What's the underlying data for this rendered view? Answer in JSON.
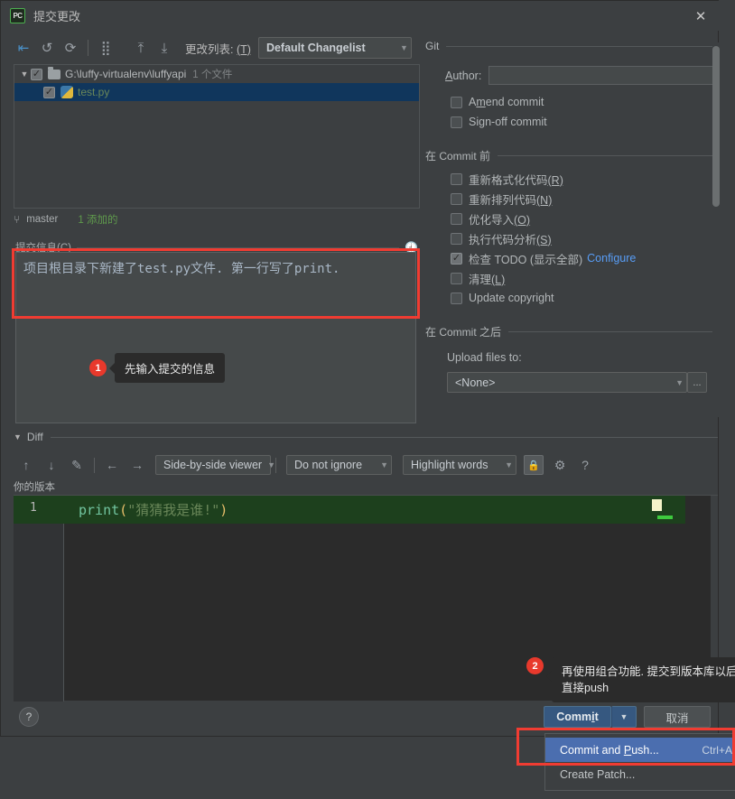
{
  "window": {
    "title": "提交更改",
    "app_icon": "pycharm-icon",
    "close_icon": "close-icon"
  },
  "toolbar": {
    "icons": [
      {
        "name": "collapse-arrows-icon",
        "glyph": "⇥"
      },
      {
        "name": "undo-icon",
        "glyph": "↺"
      },
      {
        "name": "refresh-icon",
        "glyph": "⟳"
      },
      {
        "name": "group-by-icon",
        "glyph": "⠿"
      },
      {
        "name": "expand-all-icon",
        "glyph": "⤒"
      },
      {
        "name": "collapse-all-icon",
        "glyph": "⤓"
      }
    ],
    "changelist_label": "更改列表:",
    "changelist_mnemonic": "(T)",
    "changelist_value": "Default Changelist"
  },
  "filetree": {
    "root": {
      "path": "G:\\luffy-virtualenv\\luffyapi",
      "count": "1 个文件",
      "checked": true,
      "expanded": true
    },
    "files": [
      {
        "name": "test.py",
        "checked": true,
        "selected": true,
        "icon": "python-file-icon"
      }
    ]
  },
  "branch_bar": {
    "icon": "branch-icon",
    "branch": "master",
    "added": "1 添加的"
  },
  "commit_message": {
    "label": "提交信息",
    "mnemonic": "(C)",
    "history_icon": "clock-history-icon",
    "value": "项目根目录下新建了test.py文件. 第一行写了print."
  },
  "callouts": [
    {
      "number": "1",
      "text": "先输入提交的信息"
    },
    {
      "number": "2",
      "text": "再使用组合功能. 提交到版本库以后直接push"
    }
  ],
  "git_panel": {
    "group_title": "Git",
    "author_label": "Author:",
    "author_mnemonic": "A",
    "author_value": "",
    "checkboxes": [
      {
        "label": "Amend commit",
        "mnemonic": "m",
        "checked": false
      },
      {
        "label": "Sign-off commit",
        "mnemonic": "g",
        "checked": false
      }
    ],
    "before_commit": {
      "title": "在 Commit 前",
      "items": [
        {
          "label": "重新格式化代码",
          "mnemonic": "(R)",
          "checked": false,
          "link": ""
        },
        {
          "label": "重新排列代码",
          "mnemonic": "(N)",
          "checked": false,
          "link": ""
        },
        {
          "label": "优化导入",
          "mnemonic": "(O)",
          "checked": false,
          "link": ""
        },
        {
          "label": "执行代码分析",
          "mnemonic": "(S)",
          "checked": false,
          "link": ""
        },
        {
          "label": "检查 TODO (显示全部)",
          "mnemonic": "",
          "checked": true,
          "link": "Configure"
        },
        {
          "label": "清理",
          "mnemonic": "(L)",
          "checked": false,
          "link": ""
        },
        {
          "label": "Update copyright",
          "mnemonic": "",
          "checked": false,
          "link": ""
        }
      ]
    },
    "after_commit": {
      "title": "在 Commit 之后",
      "upload_label": "Upload files to:",
      "upload_value": "<None>",
      "browse_label": "..."
    }
  },
  "diff": {
    "title": "Diff",
    "toolbar_icons": [
      {
        "name": "previous-difference-icon",
        "glyph": "↑"
      },
      {
        "name": "next-difference-icon",
        "glyph": "↓"
      },
      {
        "name": "edit-source-icon",
        "glyph": "✎"
      },
      {
        "name": "apply-left-icon",
        "glyph": "←"
      },
      {
        "name": "apply-right-icon",
        "glyph": "→"
      }
    ],
    "viewer_mode": "Side-by-side viewer",
    "ignore_mode": "Do not ignore",
    "highlight_mode": "Highlight words",
    "lock_icon": "lock-icon",
    "settings_icon": "gear-icon",
    "help_icon": "question-icon",
    "pane_label": "你的版本",
    "code": {
      "line_number": "1",
      "fn": "print",
      "open_paren": "(",
      "string": "\"猜猜我是谁!\"",
      "close_paren": ")"
    }
  },
  "bottom": {
    "help_label": "?",
    "commit_label": "Commit",
    "commit_mnemonic": "i",
    "commit_dropdown_icon": "chevron-down-icon",
    "cancel_label": "取消"
  },
  "context_menu": {
    "items": [
      {
        "label": "Commit and Push...",
        "mnemonic": "P",
        "shortcut": "Ctrl+Alt+K",
        "selected": true
      },
      {
        "label": "Create Patch...",
        "mnemonic": "",
        "shortcut": "",
        "selected": false
      }
    ]
  },
  "colors": {
    "accent_blue": "#4b6eaf",
    "highlight_red": "#f03c32",
    "added_green": "#1d401d",
    "panel_bg": "#3c3f41",
    "editor_bg": "#2b2b2b"
  }
}
